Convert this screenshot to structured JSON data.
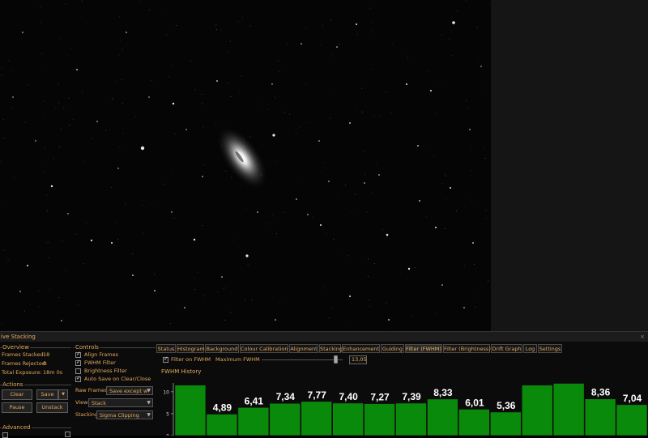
{
  "panel": {
    "title": "ive Stacking",
    "close_glyph": "× "
  },
  "overview": {
    "title": "Overview",
    "frames_stacked_label": "Frames Stacked:",
    "frames_stacked_value": "18",
    "frames_rejected_label": "Frames Rejected:",
    "frames_rejected_value": "0",
    "total_exposure_label": "Total Exposure:",
    "total_exposure_value": "18m 0s"
  },
  "actions": {
    "title": "Actions",
    "clear": "Clear",
    "save": "Save",
    "save_dropdown_glyph": "▼",
    "pause": "Pause",
    "unstack": "Unstack"
  },
  "advanced": {
    "title": "Advanced"
  },
  "controls": {
    "title": "Controls",
    "checkboxes": [
      {
        "label": "Align Frames",
        "checked": true
      },
      {
        "label": "FWHM Filter",
        "checked": true
      },
      {
        "label": "Brightness Filter",
        "checked": false
      },
      {
        "label": "Auto Save on Clear/Close",
        "checked": true
      }
    ],
    "raw_frames_label": "Raw Frames",
    "raw_frames_value": "Save except w",
    "view_label": "View",
    "view_value": "Stack",
    "stacking_label": "Stacking",
    "stacking_value": "Sigma Clipping",
    "dropdown_glyph": "▼"
  },
  "tabs": [
    "Status",
    "Histogram",
    "Background",
    "Colour Calibration",
    "Alignment",
    "Stacking",
    "Enhancement",
    "Guiding",
    "Filter (FWHM)",
    "Filter (Brightness)",
    "Drift Graph",
    "Log",
    "Settings"
  ],
  "active_tab": "Filter (FWHM)",
  "filter": {
    "checkbox_label": "Filter on FWHM",
    "checked": true,
    "max_label": "Maximum FWHM",
    "max_value": "13,05",
    "slider_fraction": 0.91
  },
  "chart_data": {
    "type": "bar",
    "title": "FWHM History",
    "ylim": [
      0,
      12
    ],
    "yticks": [
      "0",
      "5",
      "10"
    ],
    "values": [
      11.5,
      4.89,
      6.41,
      7.34,
      7.77,
      7.4,
      7.27,
      7.39,
      8.33,
      6.01,
      5.36,
      11.5,
      11.9,
      8.36,
      7.04
    ],
    "labels": [
      "",
      "4,89",
      "6,41",
      "7,34",
      "7,77",
      "7,40",
      "7,27",
      "7,39",
      "8,33",
      "6,01",
      "5,36",
      "",
      "",
      "8,36",
      "7,04"
    ],
    "bar_color": "#0a8a0a",
    "grid": false,
    "legend": "none"
  },
  "colors": {
    "accent": "#e4a95c",
    "background": "#0b0b0b"
  }
}
